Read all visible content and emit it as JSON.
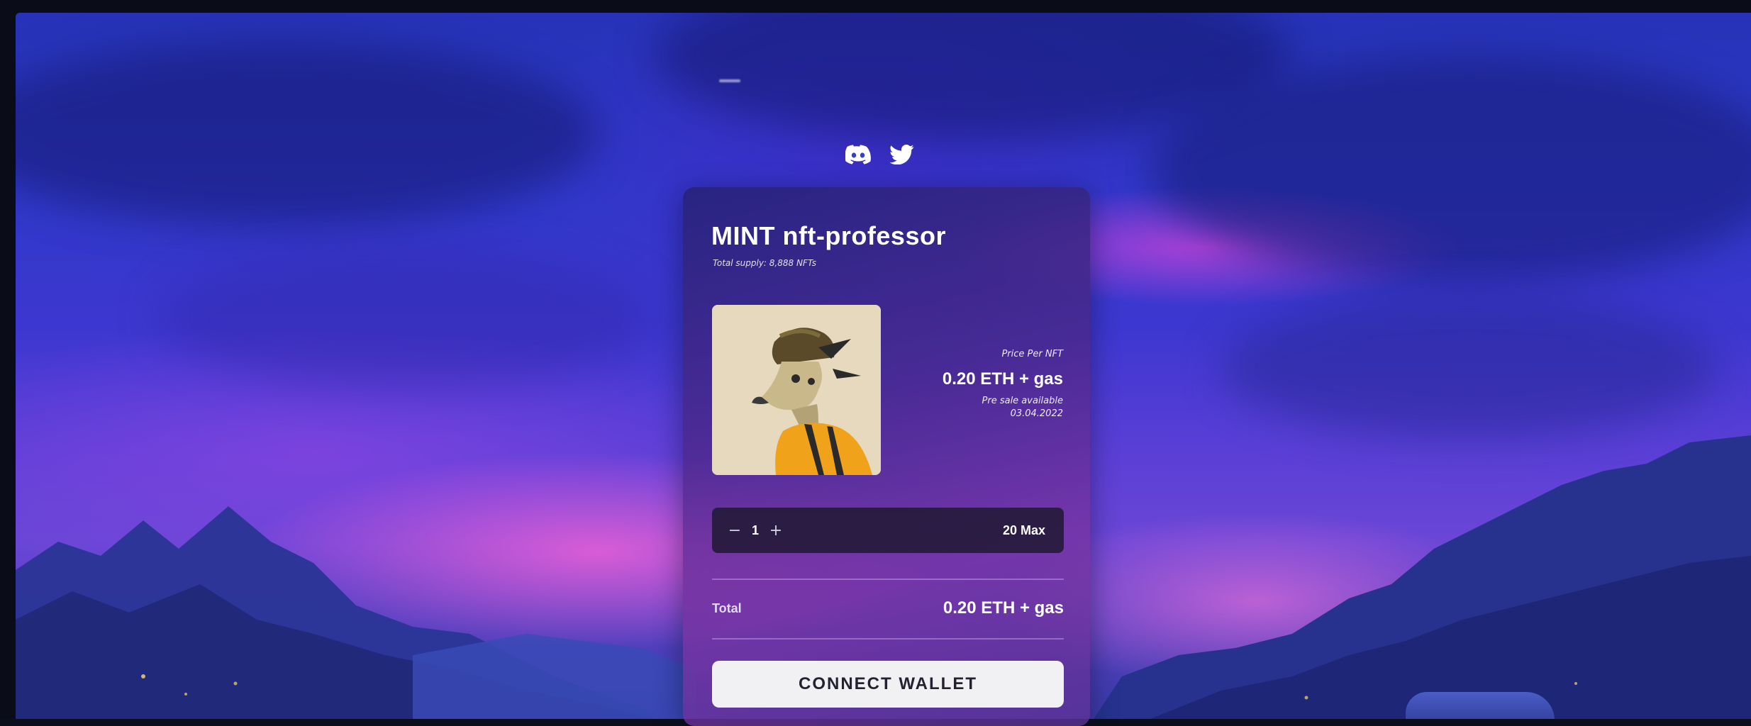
{
  "socials": {
    "discord_icon": "discord-icon",
    "twitter_icon": "twitter-icon"
  },
  "mint_card": {
    "title": "MINT nft-professor",
    "supply": "Total supply: 8,888 NFTs",
    "price_label": "Price Per NFT",
    "price_value": "0.20 ETH + gas",
    "presale_line1": "Pre sale available",
    "presale_line2": "03.04.2022",
    "quantity": {
      "minus": "−",
      "value": "1",
      "plus": "+",
      "max_label": "20 Max"
    },
    "total_label": "Total",
    "total_value": "0.20 ETH + gas",
    "connect_button": "CONNECT WALLET"
  },
  "colors": {
    "sky_top": "#2633b8",
    "glow_pink": "#ec60d6",
    "card_purple": "#4a288c",
    "button_bg": "#f1f1f4",
    "button_text": "#222230"
  }
}
